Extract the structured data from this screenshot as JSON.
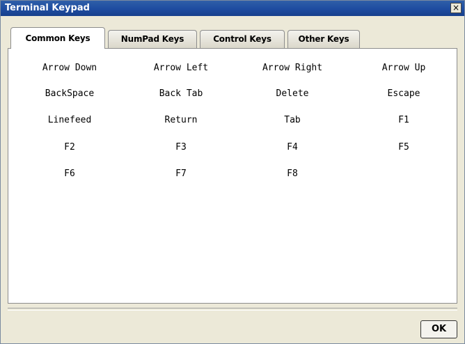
{
  "window": {
    "title": "Terminal Keypad",
    "close_glyph": "×"
  },
  "tabs": [
    {
      "label": "Common Keys",
      "active": true
    },
    {
      "label": "NumPad Keys",
      "active": false
    },
    {
      "label": "Control Keys",
      "active": false
    },
    {
      "label": "Other Keys",
      "active": false
    }
  ],
  "keys": [
    [
      "Arrow Down",
      "Arrow Left",
      "Arrow Right",
      "Arrow Up"
    ],
    [
      "BackSpace",
      "Back Tab",
      "Delete",
      "Escape"
    ],
    [
      "Linefeed",
      "Return",
      "Tab",
      "F1"
    ],
    [
      "F2",
      "F3",
      "F4",
      "F5"
    ],
    [
      "F6",
      "F7",
      "F8"
    ]
  ],
  "footer": {
    "ok_label": "OK"
  },
  "colors": {
    "title_bar": "#1E4CA0",
    "dialog_bg": "#ECE9D8",
    "panel_bg": "#FFFFFF"
  },
  "icons": {
    "close": "close-icon"
  }
}
